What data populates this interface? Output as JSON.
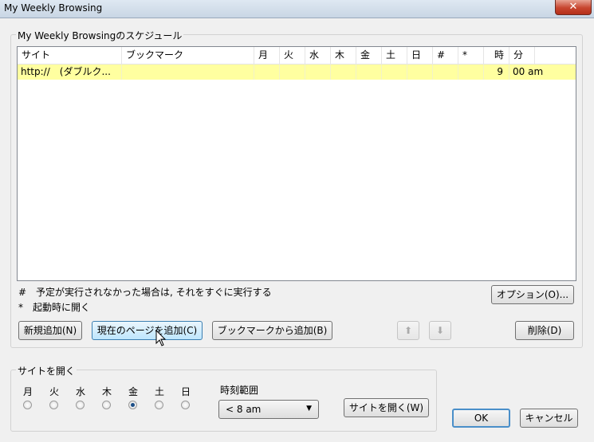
{
  "window": {
    "title": "My Weekly Browsing",
    "close_label": "✕"
  },
  "schedule": {
    "legend": "My Weekly Browsingのスケジュール",
    "columns": [
      "サイト",
      "ブックマーク",
      "月",
      "火",
      "水",
      "木",
      "金",
      "土",
      "日",
      "#",
      "*",
      "時",
      "分"
    ],
    "rows": [
      {
        "site": "http://　(ダブルク...",
        "bookmark": "",
        "mon": "",
        "tue": "",
        "wed": "",
        "thu": "",
        "fri": "",
        "sat": "",
        "sun": "",
        "hash": "",
        "star": "",
        "hour": "9",
        "minute": "00 am"
      }
    ]
  },
  "notes": {
    "hash": "#　予定が実行されなかった場合は, それをすぐに実行する",
    "star": "*　起動時に開く"
  },
  "buttons": {
    "options": "オプション(O)...",
    "new": "新規追加(N)",
    "add_current": "現在のページを追加(C)",
    "add_bookmark": "ブックマークから追加(B)",
    "up": "⬆",
    "down": "⬇",
    "delete": "削除(D)",
    "open_site": "サイトを開く(W)",
    "ok": "OK",
    "cancel": "キャンセル"
  },
  "open_sites": {
    "legend": "サイトを開く",
    "days": [
      "月",
      "火",
      "水",
      "木",
      "金",
      "土",
      "日"
    ],
    "selected_day_index": 4,
    "time_range_label": "時刻範囲",
    "time_range_value": "< 8 am"
  }
}
